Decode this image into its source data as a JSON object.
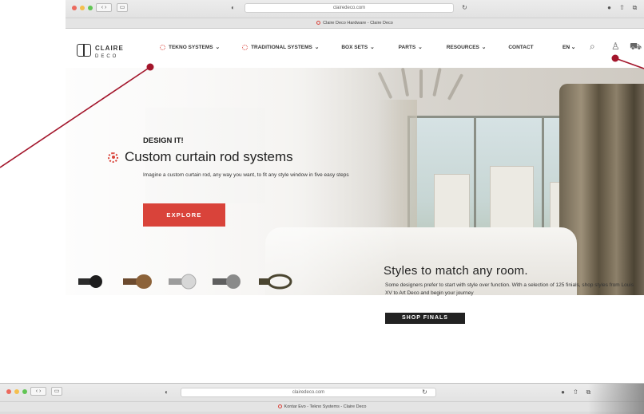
{
  "browser_top": {
    "url": "clairedeco.com",
    "tab_title": "Claire Deco Hardware - Claire Deco"
  },
  "browser_bottom": {
    "url": "clairedeco.com",
    "tab_title": "Kontar Evo - Tekno Systems - Claire Deco"
  },
  "site": {
    "logo_name": "CLAIRE",
    "logo_sub": "DECO",
    "nav": [
      {
        "label": "TEKNO SYSTEMS",
        "has_icon": true
      },
      {
        "label": "TRADITIONAL SYSTEMS",
        "has_icon": true
      },
      {
        "label": "BOX SETS",
        "has_icon": false
      },
      {
        "label": "PARTS",
        "has_icon": false
      },
      {
        "label": "RESOURCES",
        "has_icon": false
      },
      {
        "label": "CONTACT",
        "has_icon": false
      }
    ],
    "lang": "EN"
  },
  "hero": {
    "eyebrow": "DESIGN IT!",
    "headline": "Custom curtain rod systems",
    "description": "Imagine a custom curtain rod, any way you want, to fit any style window in five easy steps",
    "cta": "EXPLORE"
  },
  "styles": {
    "title": "Styles to match any room.",
    "description": "Some designers prefer to start with style over function. With a selection of 125 finials,  shop styles from Louis XV to Art Deco and begin your journey",
    "cta": "SHOP FINALS"
  },
  "colors": {
    "accent": "#d9433a",
    "annotation": "#a3152b"
  }
}
